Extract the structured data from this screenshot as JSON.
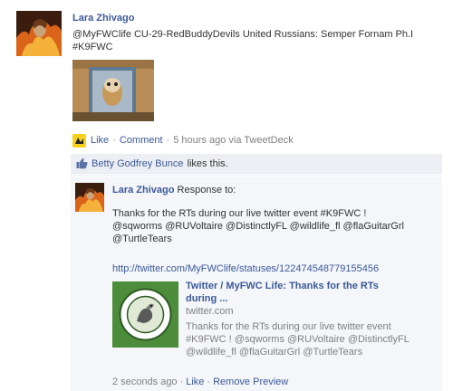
{
  "post": {
    "author": "Lara Zhivago",
    "message": "@MyFWClife CU-29-RedBuddyDevils United Russians: Semper Fornam Ph.I\n#K9FWC",
    "photo_icon": "owl-photo",
    "actions": {
      "like": "Like",
      "comment": "Comment",
      "separator": "·",
      "timestamp": "5 hours ago via TweetDeck"
    }
  },
  "likes": {
    "liker": "Betty Godfrey Bunce",
    "suffix": "likes this."
  },
  "comment": {
    "author": "Lara Zhivago",
    "response_label": "Response to:",
    "text": "Thanks for the RTs during our live twitter event #K9FWC !\n@sqworms @RUVoltaire @DistinctlyFL @wildlife_fl @flaGuitarGrl\n@TurtleTears",
    "url": "http://twitter.com/MyFWClife/statuses/122474548779155456",
    "preview": {
      "title": "Twitter / MyFWC Life: Thanks for the RTs during ...",
      "domain": "twitter.com",
      "description": "Thanks for the RTs during our live twitter event #K9FWC ! @sqworms @RUVoltaire @DistinctlyFL @wildlife_fl @flaGuitarGrl @TurtleTears"
    },
    "meta": {
      "timestamp": "2 seconds ago",
      "separator": "·",
      "like": "Like",
      "remove_preview": "Remove Preview"
    }
  },
  "colors": {
    "link": "#3b5998",
    "meta_gray": "#808080",
    "comment_bg": "#edeff4",
    "preview_green": "#4c8c3a"
  }
}
